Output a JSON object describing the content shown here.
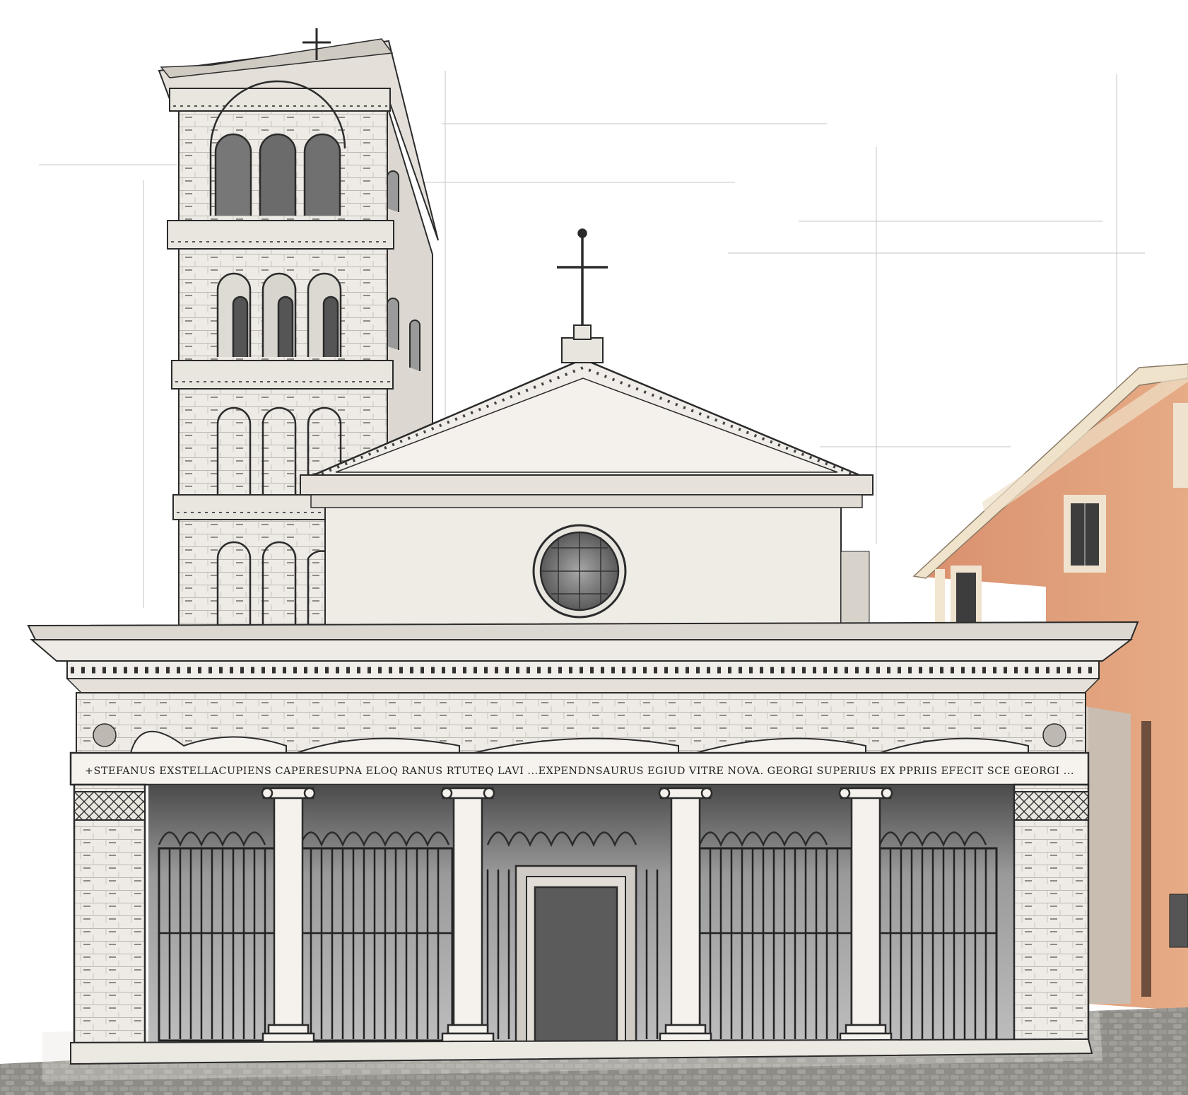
{
  "image": {
    "subject": "pencil-sketch illustration of a Romanesque basilica facade with bell tower, pedimented front, portico with Ionic columns and iron gates, next to an orange plastered building",
    "inscription": "+STEFANUS EXSTELLACUPIENS CAPERESUPNA ELOQ RANUS RTUTEQ LAVI ...EXPENDNSAURUS EGIUD VITRE NOVA. GEORGI SUPERIUS EX PPRIIS EFECIT SCE GEORGI ...",
    "colors": {
      "sketch_line": "#2b2b2b",
      "paper": "#f1efeb",
      "shade_dark": "#6e6e6e",
      "orange_wall": "#e0a27e",
      "cream_trim": "#efe3cf",
      "cobblestone": "#8a8a86",
      "sky": "#ffffff"
    }
  }
}
